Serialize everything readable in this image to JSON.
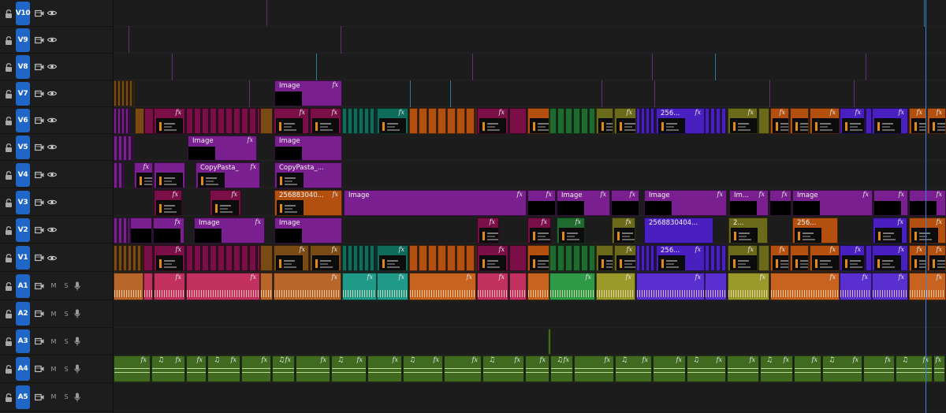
{
  "colors": {
    "accent": "#2066c6",
    "playhead": "#3b82d6",
    "magenta": "#7a0f48",
    "purple": "#7a1f8f",
    "violet": "#4a1fbf",
    "orange": "#b4500f",
    "teal": "#0f6b5a",
    "green": "#1f6b2f",
    "olive": "#6b6a1a",
    "brown": "#7a4a14",
    "music": "#3f6a1f"
  },
  "tracks": {
    "video": [
      {
        "id": "V10",
        "label": "V10",
        "lock_icon": "lock-icon",
        "toggle_icon": "film-icon",
        "eye_icon": "eye-icon"
      },
      {
        "id": "V9",
        "label": "V9",
        "lock_icon": "lock-icon",
        "toggle_icon": "film-icon",
        "eye_icon": "eye-icon"
      },
      {
        "id": "V8",
        "label": "V8",
        "lock_icon": "lock-icon",
        "toggle_icon": "film-icon",
        "eye_icon": "eye-icon"
      },
      {
        "id": "V7",
        "label": "V7",
        "lock_icon": "lock-icon",
        "toggle_icon": "film-icon",
        "eye_icon": "eye-icon"
      },
      {
        "id": "V6",
        "label": "V6",
        "lock_icon": "lock-icon",
        "toggle_icon": "film-icon",
        "eye_icon": "eye-icon"
      },
      {
        "id": "V5",
        "label": "V5",
        "lock_icon": "lock-icon",
        "toggle_icon": "film-icon",
        "eye_icon": "eye-icon"
      },
      {
        "id": "V4",
        "label": "V4",
        "lock_icon": "lock-icon",
        "toggle_icon": "film-icon",
        "eye_icon": "eye-icon"
      },
      {
        "id": "V3",
        "label": "V3",
        "lock_icon": "lock-icon",
        "toggle_icon": "film-icon",
        "eye_icon": "eye-icon"
      },
      {
        "id": "V2",
        "label": "V2",
        "lock_icon": "lock-icon",
        "toggle_icon": "film-icon",
        "eye_icon": "eye-icon"
      },
      {
        "id": "V1",
        "label": "V1",
        "lock_icon": "lock-icon",
        "toggle_icon": "film-icon",
        "eye_icon": "eye-icon"
      }
    ],
    "audio": [
      {
        "id": "A1",
        "label": "A1",
        "mute": "M",
        "solo": "S",
        "mic_icon": "mic-icon"
      },
      {
        "id": "A2",
        "label": "A2",
        "mute": "M",
        "solo": "S",
        "mic_icon": "mic-icon"
      },
      {
        "id": "A3",
        "label": "A3",
        "mute": "M",
        "solo": "S",
        "mic_icon": "mic-icon"
      },
      {
        "id": "A4",
        "label": "A4",
        "mute": "M",
        "solo": "S",
        "mic_icon": "mic-icon"
      },
      {
        "id": "A5",
        "label": "A5",
        "mute": "M",
        "solo": "S",
        "mic_icon": "mic-icon"
      }
    ]
  },
  "clip_labels": {
    "image": "Image",
    "copypasta": "CopyPasta_",
    "copypasta_trunc": "CopyPasta_...",
    "num_a": "256883040...",
    "num_b": "2568830404...",
    "num_short": "256...",
    "num_2": "2...",
    "im_short": "Im...",
    "fx": "fx",
    "note": "♫"
  }
}
